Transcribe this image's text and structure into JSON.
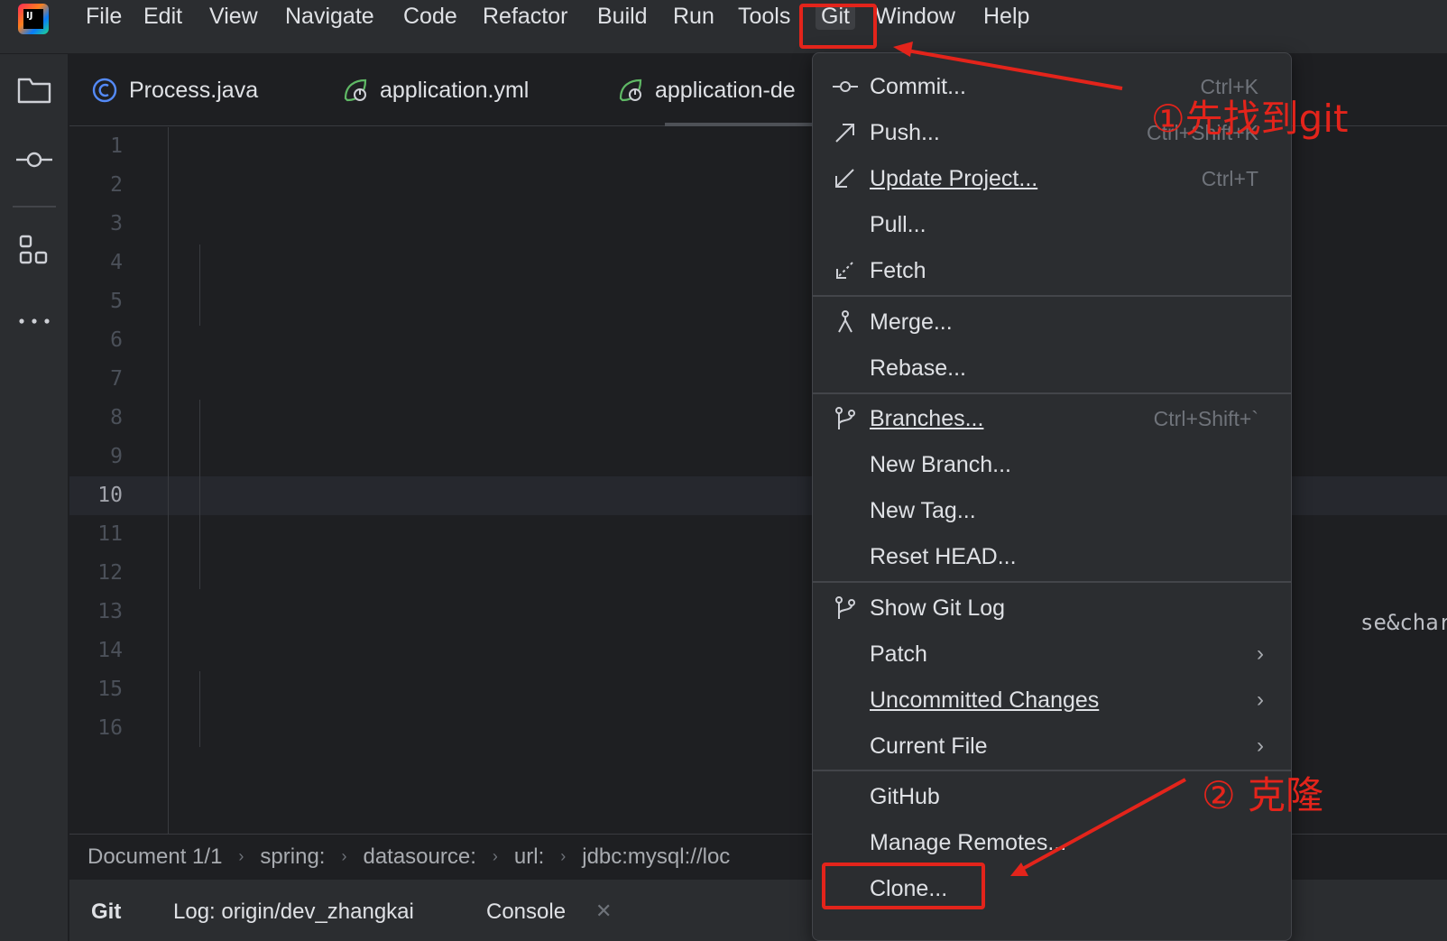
{
  "menubar": {
    "logo_text": "IJ",
    "items": [
      "File",
      "Edit",
      "View",
      "Navigate",
      "Code",
      "Refactor",
      "Build",
      "Run",
      "Tools",
      "Git",
      "Window",
      "Help"
    ]
  },
  "tabs": [
    {
      "label": "Process.java",
      "icon": "java-class-icon"
    },
    {
      "label": "application.yml",
      "icon": "spring-config-icon"
    },
    {
      "label": "application-de",
      "icon": "spring-config-icon"
    }
  ],
  "editor": {
    "line_numbers": [
      "1",
      "2",
      "3",
      "4",
      "5",
      "6",
      "7",
      "8",
      "9",
      "10",
      "11",
      "12",
      "13",
      "14",
      "15",
      "16"
    ],
    "current_line": "10",
    "overflow_text": "se&charac"
  },
  "breadcrumbs": [
    "Document 1/1",
    "spring:",
    "datasource:",
    "url:",
    "jdbc:mysql://loc"
  ],
  "bottom_tabs": [
    "Git",
    "Log: origin/dev_zhangkai",
    "Console"
  ],
  "git_menu": {
    "items": [
      {
        "label": "Commit...",
        "shortcut": "Ctrl+K",
        "icon": "commit-icon"
      },
      {
        "label": "Push...",
        "shortcut": "Ctrl+Shift+K",
        "icon": "push-arrow-icon"
      },
      {
        "label": "Update Project...",
        "shortcut": "Ctrl+T",
        "icon": "update-arrow-icon"
      },
      {
        "label": "Pull...",
        "shortcut": "",
        "icon": ""
      },
      {
        "label": "Fetch",
        "shortcut": "",
        "icon": "fetch-icon"
      },
      {
        "label": "Merge...",
        "shortcut": "",
        "icon": "merge-icon"
      },
      {
        "label": "Rebase...",
        "shortcut": "",
        "icon": ""
      },
      {
        "label": "Branches...",
        "shortcut": "Ctrl+Shift+`",
        "icon": "branch-icon"
      },
      {
        "label": "New Branch...",
        "shortcut": "",
        "icon": ""
      },
      {
        "label": "New Tag...",
        "shortcut": "",
        "icon": ""
      },
      {
        "label": "Reset HEAD...",
        "shortcut": "",
        "icon": ""
      },
      {
        "label": "Show Git Log",
        "shortcut": "",
        "icon": "git-log-icon"
      },
      {
        "label": "Patch",
        "shortcut": "",
        "icon": "",
        "submenu": true
      },
      {
        "label": "Uncommitted Changes",
        "shortcut": "",
        "icon": "",
        "submenu": true
      },
      {
        "label": "Current File",
        "shortcut": "",
        "icon": "",
        "submenu": true
      },
      {
        "label": "GitHub",
        "shortcut": "",
        "icon": ""
      },
      {
        "label": "Manage Remotes...",
        "shortcut": "",
        "icon": ""
      },
      {
        "label": "Clone...",
        "shortcut": "",
        "icon": ""
      }
    ],
    "submenu_arrow": "›"
  },
  "annotations": {
    "step1": "①先找到git",
    "step2": "② 克隆",
    "color": "#e3241b"
  }
}
